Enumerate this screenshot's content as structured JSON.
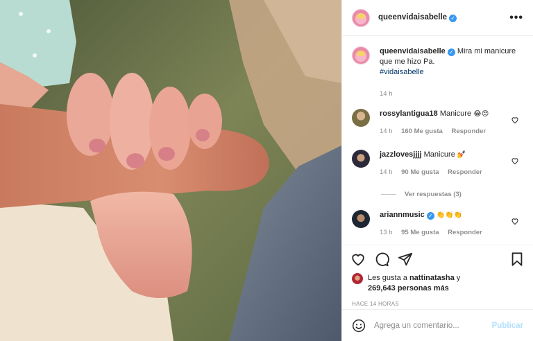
{
  "post": {
    "author": "queenvidaisabelle",
    "more_icon": "more-options-icon"
  },
  "caption": {
    "author": "queenvidaisabelle",
    "text": "Mira mi manicure que me hizo Pa.",
    "hashtag": "#vidaisabelle",
    "time": "14 h"
  },
  "comments": [
    {
      "user": "rossylantigua18",
      "text": "Manicure",
      "emoji": "😂😍",
      "time": "14 h",
      "likes": "160 Me gusta",
      "reply": "Responder",
      "verified": false
    },
    {
      "user": "jazzlovesjjjj",
      "text": "Manicure",
      "emoji": "💅",
      "time": "14 h",
      "likes": "90 Me gusta",
      "reply": "Responder",
      "verified": false
    },
    {
      "user": "ariannmusic",
      "text": "",
      "emoji": "👏👏👏",
      "time": "13 h",
      "likes": "95 Me gusta",
      "reply": "Responder",
      "verified": true
    }
  ],
  "view_replies": "Ver respuestas (3)",
  "likes_line": {
    "prefix": "Les gusta a",
    "user": "nattinatasha",
    "suffix": "y",
    "count": "269,643 personas más"
  },
  "timestamp": "HACE 14 HORAS",
  "add_comment": {
    "placeholder": "Agrega un comentario...",
    "publish": "Publicar"
  },
  "colors": {
    "link": "#00376b",
    "verified": "#3897f0",
    "publish_disabled": "#b2dffc",
    "muted": "#8e8e8e"
  }
}
